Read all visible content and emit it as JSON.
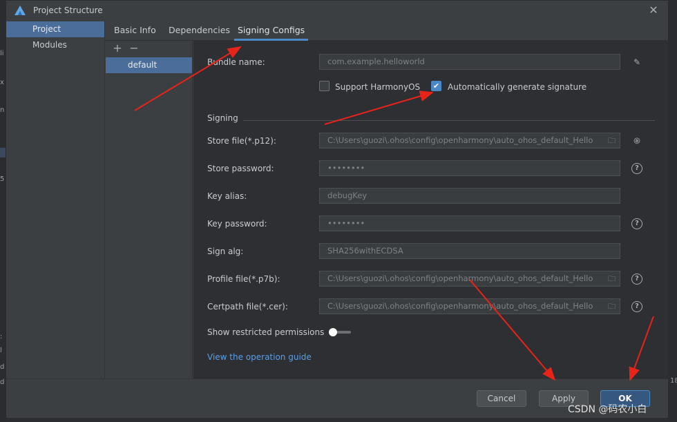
{
  "window": {
    "title": "Project Structure",
    "close_glyph": "✕"
  },
  "nav": {
    "items": [
      {
        "label": "Project",
        "active": true
      },
      {
        "label": "Modules",
        "active": false
      }
    ]
  },
  "tabs": [
    {
      "label": "Basic Info",
      "active": false
    },
    {
      "label": "Signing Configs",
      "active": true
    },
    {
      "label": "Dependencies",
      "active": false
    }
  ],
  "config_list": {
    "add_glyph": "+",
    "remove_glyph": "−",
    "items": [
      {
        "label": "default"
      }
    ]
  },
  "form": {
    "bundle_name": {
      "label": "Bundle name:",
      "value": "com.example.helloworld"
    },
    "support_harmonyos": {
      "label": "Support HarmonyOS",
      "checked": false
    },
    "auto_signature": {
      "label": "Automatically generate signature",
      "checked": true
    },
    "signing_section": "Signing",
    "store_file": {
      "label": "Store file(*.p12):",
      "value": "C:\\Users\\guozi\\.ohos\\config\\openharmony\\auto_ohos_default_Hello"
    },
    "store_password": {
      "label": "Store password:",
      "value": "••••••••"
    },
    "key_alias": {
      "label": "Key alias:",
      "value": "debugKey"
    },
    "key_password": {
      "label": "Key password:",
      "value": "••••••••"
    },
    "sign_alg": {
      "label": "Sign alg:",
      "value": "SHA256withECDSA"
    },
    "profile_file": {
      "label": "Profile file(*.p7b):",
      "value": "C:\\Users\\guozi\\.ohos\\config\\openharmony\\auto_ohos_default_Hello"
    },
    "certpath_file": {
      "label": "Certpath file(*.cer):",
      "value": "C:\\Users\\guozi\\.ohos\\config\\openharmony\\auto_ohos_default_Hello"
    },
    "show_restricted": {
      "label": "Show restricted permissions",
      "on": false
    },
    "guide_link": "View the operation guide",
    "help_glyph": "?",
    "edit_glyph": "✎",
    "folder_glyph": "🗀",
    "fingerprint_glyph": "֍"
  },
  "footer": {
    "cancel": "Cancel",
    "apply": "Apply",
    "ok": "OK"
  },
  "watermark": "CSDN @码农小白",
  "colors": {
    "accent": "#4a88c7",
    "selection": "#4a6d9a",
    "arrow": "#e8231a",
    "link": "#5a9ee8"
  }
}
